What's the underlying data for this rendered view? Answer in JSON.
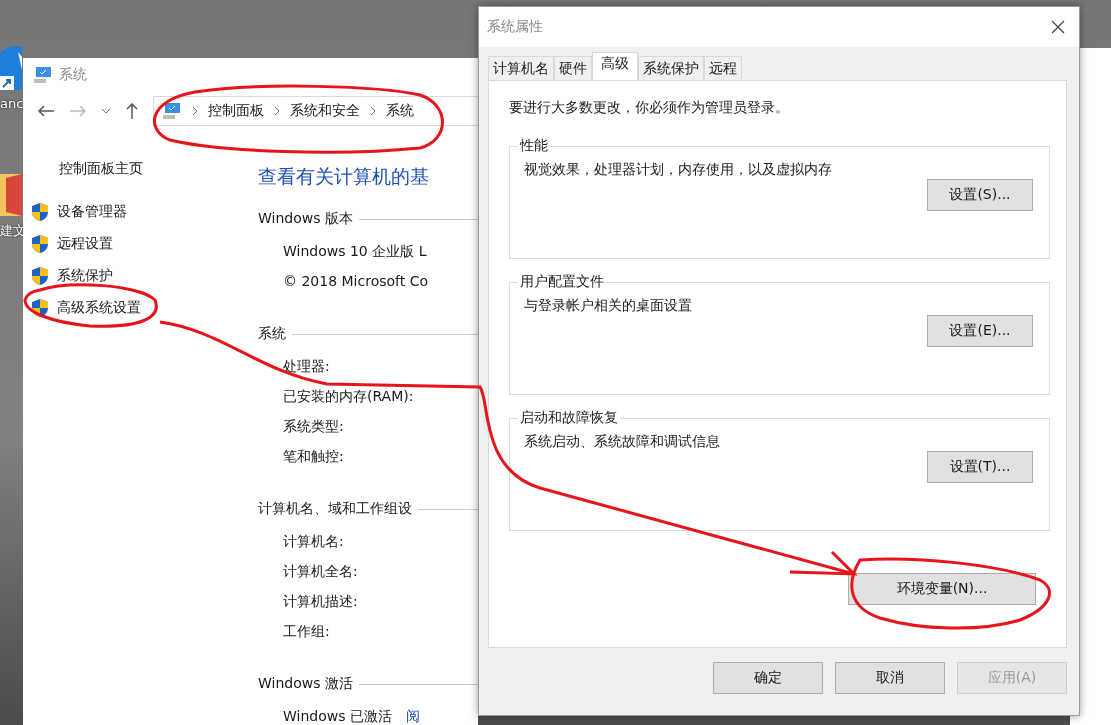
{
  "desktop": {
    "icons": [
      {
        "label": "anc"
      },
      {
        "label": "建文"
      }
    ]
  },
  "system_window": {
    "title": "系统",
    "breadcrumb": [
      "控制面板",
      "系统和安全",
      "系统"
    ],
    "sidebar": {
      "home": "控制面板主页",
      "links": [
        "设备管理器",
        "远程设置",
        "系统保护",
        "高级系统设置"
      ]
    },
    "heading": "查看有关计算机的基",
    "sections": [
      {
        "title": "Windows 版本",
        "rows": [
          "Windows 10 企业版 L",
          "© 2018 Microsoft Co"
        ]
      },
      {
        "title": "系统",
        "rows": [
          "处理器:",
          "已安装的内存(RAM):",
          "系统类型:",
          "笔和触控:"
        ]
      },
      {
        "title": "计算机名、域和工作组设",
        "rows": [
          "计算机名:",
          "计算机全名:",
          "计算机描述:",
          "工作组:"
        ]
      },
      {
        "title": "Windows 激活",
        "rows": [
          "Windows 已激活"
        ],
        "link": "阅"
      }
    ]
  },
  "dialog": {
    "title": "系统属性",
    "tabs": [
      {
        "label": "计算机名",
        "selected": false
      },
      {
        "label": "硬件",
        "selected": false
      },
      {
        "label": "高级",
        "selected": true
      },
      {
        "label": "系统保护",
        "selected": false
      },
      {
        "label": "远程",
        "selected": false
      }
    ],
    "notice": "要进行大多数更改，你必须作为管理员登录。",
    "groups": [
      {
        "title": "性能",
        "description": "视觉效果，处理器计划，内存使用，以及虚拟内存",
        "button": "设置(S)..."
      },
      {
        "title": "用户配置文件",
        "description": "与登录帐户相关的桌面设置",
        "button": "设置(E)..."
      },
      {
        "title": "启动和故障恢复",
        "description": "系统启动、系统故障和调试信息",
        "button": "设置(T)..."
      }
    ],
    "env_button": "环境变量(N)...",
    "buttons": [
      {
        "label": "确定",
        "disabled": false
      },
      {
        "label": "取消",
        "disabled": false
      },
      {
        "label": "应用(A)",
        "disabled": true
      }
    ]
  }
}
